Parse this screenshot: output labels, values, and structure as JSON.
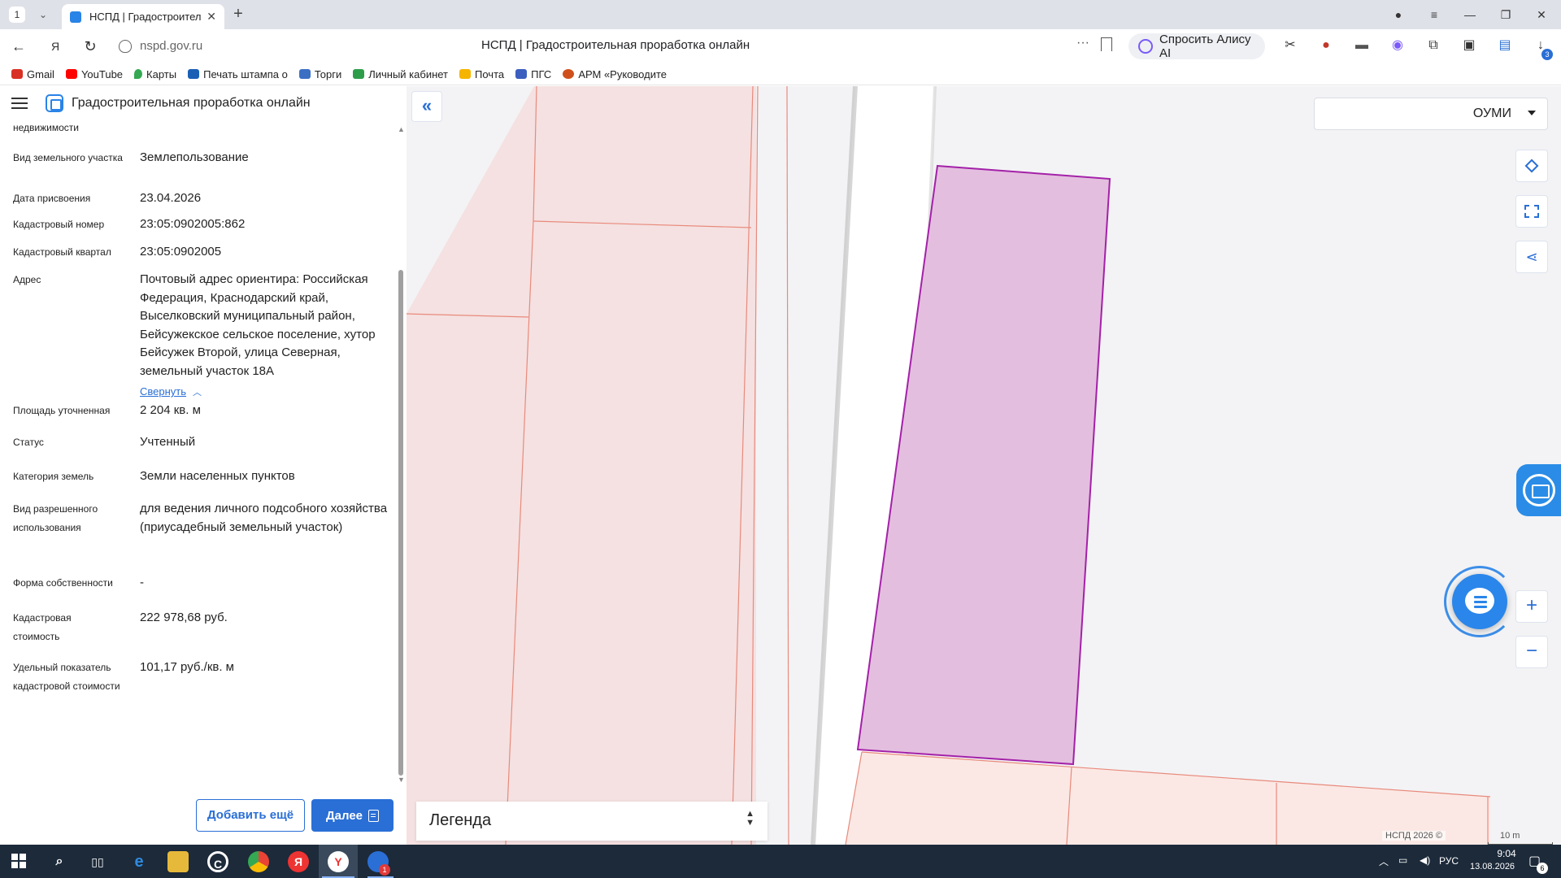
{
  "browser": {
    "tab_count": "1",
    "tab_title": "НСПД | Градостроитель",
    "url": "nspd.gov.ru",
    "page_title": "НСПД | Градостроительная проработка онлайн",
    "alice_label": "Спросить Алису AI",
    "extension_badge": "3"
  },
  "bookmarks": [
    {
      "label": "Gmail",
      "color": "#d93025"
    },
    {
      "label": "YouTube",
      "color": "#ff0000"
    },
    {
      "label": "Карты",
      "color": "#34a853"
    },
    {
      "label": "Печать штампа о",
      "color": "#1a5fb4"
    },
    {
      "label": "Торги",
      "color": "#3b6fc4"
    },
    {
      "label": "Личный кабинет",
      "color": "#2e9d4a"
    },
    {
      "label": "Почта",
      "color": "#f5b400"
    },
    {
      "label": "ПГС",
      "color": "#3b5fbf"
    },
    {
      "label": "АРМ «Руководите",
      "color": "#d0501c"
    }
  ],
  "app": {
    "title": "Градостроительная проработка онлайн"
  },
  "properties": {
    "partial_label": "недвижимости",
    "rows": [
      {
        "label": "Вид земельного участка",
        "value": "Землепользование"
      },
      {
        "label": "Дата присвоения",
        "value": "23.04.2026"
      },
      {
        "label": "Кадастровый номер",
        "value": "23:05:0902005:862"
      },
      {
        "label": "Кадастровый квартал",
        "value": "23:05:0902005"
      },
      {
        "label": "Адрес",
        "value": "Почтовый адрес ориентира: Российская Федерация, Краснодарский край, Выселковский муниципальный район, Бейсужекское сельское поселение, хутор Бейсужек Второй, улица Северная, земельный участок 18А"
      },
      {
        "label": "Площадь уточненная",
        "value": "2 204 кв. м"
      },
      {
        "label": "Статус",
        "value": "Учтенный"
      },
      {
        "label": "Категория земель",
        "value": "Земли населенных пунктов"
      },
      {
        "label": "Вид разрешенного использования",
        "value": "для ведения личного подсобного хозяйства (приусадебный земельный участок)"
      },
      {
        "label": "Форма собственности",
        "value": "-"
      },
      {
        "label": "Кадастровая стоимость",
        "value": "222 978,68 руб."
      },
      {
        "label": "Удельный показатель кадастровой стоимости",
        "value": "101,17 руб./кв. м"
      }
    ],
    "collapse_link": "Свернуть"
  },
  "buttons": {
    "add_more": "Добавить ещё",
    "next": "Далее"
  },
  "map": {
    "layer_select_value": "ОУМИ",
    "legend_label": "Легенда",
    "copyright": "НСПД 2026 ©",
    "scale_label": "10 m",
    "colors": {
      "parcel_selected_fill": "#e4bedf",
      "parcel_selected_stroke": "#a321a8",
      "parcel_fill": "#f5e1e1",
      "parcel_stroke": "#e88a7c",
      "road": "#ffffff",
      "accent": "#2a6fd6"
    }
  },
  "taskbar": {
    "language": "РУС",
    "time": "9:04",
    "date": "13.08.2026",
    "notification_count": "6",
    "yandex_badge": "1"
  }
}
